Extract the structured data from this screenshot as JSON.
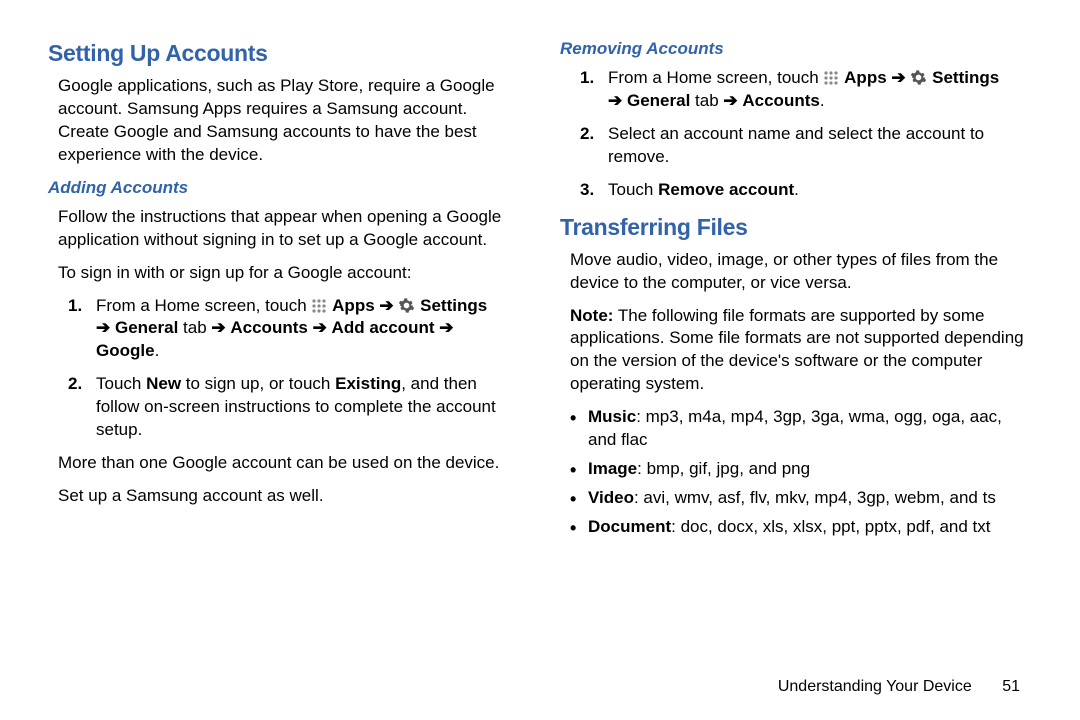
{
  "arrow": "➔",
  "left": {
    "h1": "Setting Up Accounts",
    "intro": "Google applications, such as Play Store, require a Google account. Samsung Apps requires a Samsung account. Create Google and Samsung accounts to have the best experience with the device.",
    "h2_adding": "Adding Accounts",
    "adding_p1": "Follow the instructions that appear when opening a Google application without signing in to set up a Google account.",
    "adding_p2": "To sign in with or sign up for a Google account:",
    "step1_a": "From a Home screen, touch ",
    "step1_apps": " Apps ",
    "step1_settings": " Settings ",
    "step1_general": " General",
    "step1_tab": " tab ",
    "step1_accounts": " Accounts ",
    "step1_addacct": " Add account ",
    "step1_google": " Google",
    "step1_period": ".",
    "step2_a": "Touch ",
    "step2_new": "New",
    "step2_b": " to sign up, or touch ",
    "step2_existing": "Existing",
    "step2_c": ", and then follow on-screen instructions to complete the account setup.",
    "more_p1": "More than one Google account can be used on the device.",
    "more_p2": "Set up a Samsung account as well."
  },
  "right": {
    "h2_removing": "Removing Accounts",
    "r_step1_a": "From a Home screen, touch ",
    "r_step1_apps": " Apps ",
    "r_step1_settings": " Settings ",
    "r_step1_general": " General",
    "r_step1_tab": " tab ",
    "r_step1_accounts": " Accounts",
    "r_step1_period": ".",
    "r_step2": "Select an account name and select the account to remove.",
    "r_step3_a": "Touch ",
    "r_step3_b": "Remove account",
    "r_step3_c": ".",
    "h1_transfer": "Transferring Files",
    "t_p1": "Move audio, video, image, or other types of files from the device to the computer, or vice versa.",
    "t_note_label": "Note:",
    "t_note": " The following file formats are supported by some applications. Some file formats are not supported depending on the version of the device's software or the computer operating system.",
    "fmt_music_l": "Music",
    "fmt_music": ": mp3, m4a, mp4, 3gp, 3ga, wma, ogg, oga, aac, and flac",
    "fmt_image_l": "Image",
    "fmt_image": ": bmp, gif, jpg, and png",
    "fmt_video_l": "Video",
    "fmt_video": ": avi, wmv, asf, flv, mkv, mp4, 3gp, webm, and ts",
    "fmt_doc_l": "Document",
    "fmt_doc": ": doc, docx, xls, xlsx, ppt, pptx, pdf, and txt"
  },
  "footer": {
    "section": "Understanding Your Device",
    "page": "51"
  },
  "nums": {
    "n1": "1.",
    "n2": "2.",
    "n3": "3."
  }
}
